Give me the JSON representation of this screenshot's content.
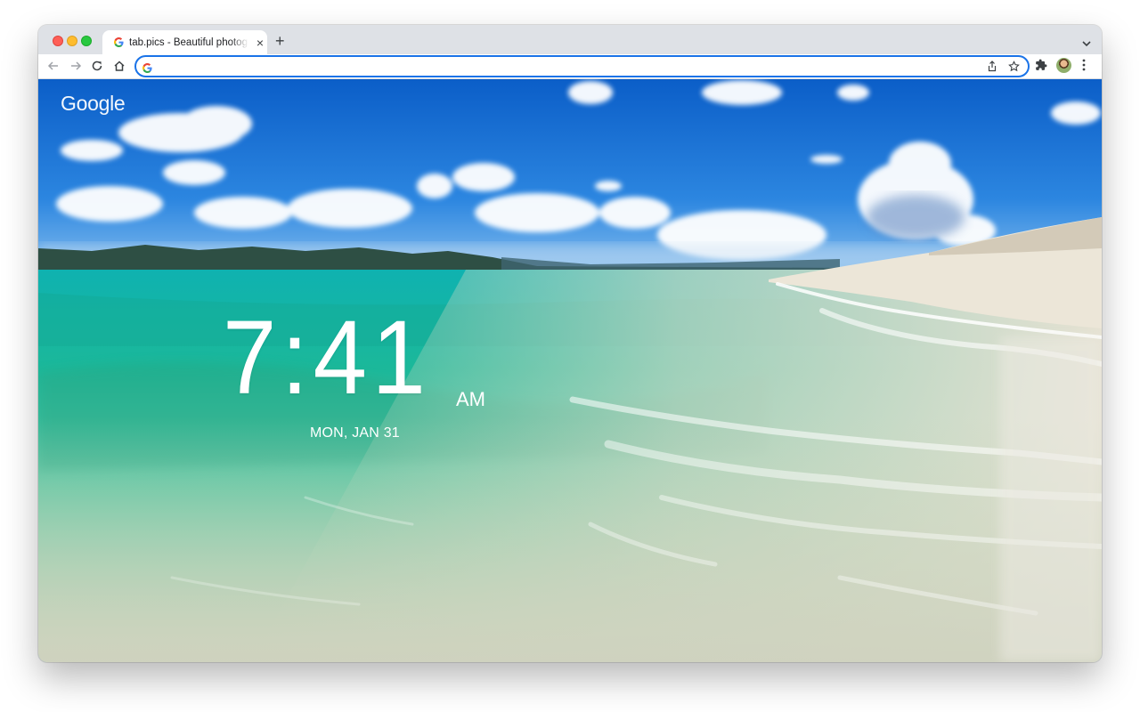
{
  "browser": {
    "tab": {
      "title": "tab.pics - Beautiful photographs",
      "close_glyph": "×"
    },
    "new_tab_glyph": "+",
    "address_bar": {
      "value": "",
      "placeholder": ""
    }
  },
  "newtab": {
    "logo": "Google",
    "clock": {
      "time": "7:41",
      "ampm": "AM",
      "date": "MON, JAN 31"
    }
  },
  "icons": {
    "back": "arrow-left-icon",
    "forward": "arrow-right-icon",
    "reload": "reload-icon",
    "home": "home-icon",
    "share": "share-icon",
    "bookmark": "star-icon",
    "extensions": "puzzle-icon",
    "menu": "kebab-menu-icon"
  },
  "colors": {
    "accent": "#1a73e8",
    "tabstrip": "#dee1e6",
    "sky": "#0d62c9",
    "water": "#1fb8a0",
    "sand": "#eae4d6"
  }
}
